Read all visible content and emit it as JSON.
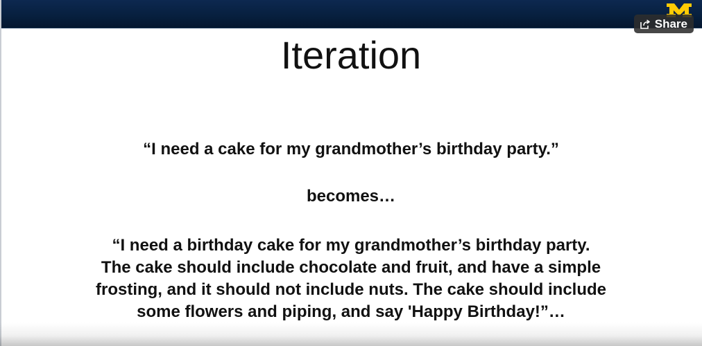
{
  "slide": {
    "title": "Iteration",
    "quote_one": "“I need a cake for my grandmother’s birthday party.”",
    "connector": "becomes…",
    "quote_two_lines": [
      "“I need a birthday cake for my grandmother’s birthday party.",
      "The cake should include chocolate and fruit, and have a simple",
      "frosting, and it should not include nuts. The cake should include",
      "some flowers and piping, and say 'Happy Birthday!”…"
    ]
  },
  "player": {
    "share_label": "Share",
    "share_icon": "share-icon",
    "logo_icon": "block-m-logo"
  },
  "colors": {
    "top_bar": "#07203f",
    "logo_maize": "#ffcb05",
    "share_button_bg": "#2d2d2d",
    "text": "#111111"
  }
}
